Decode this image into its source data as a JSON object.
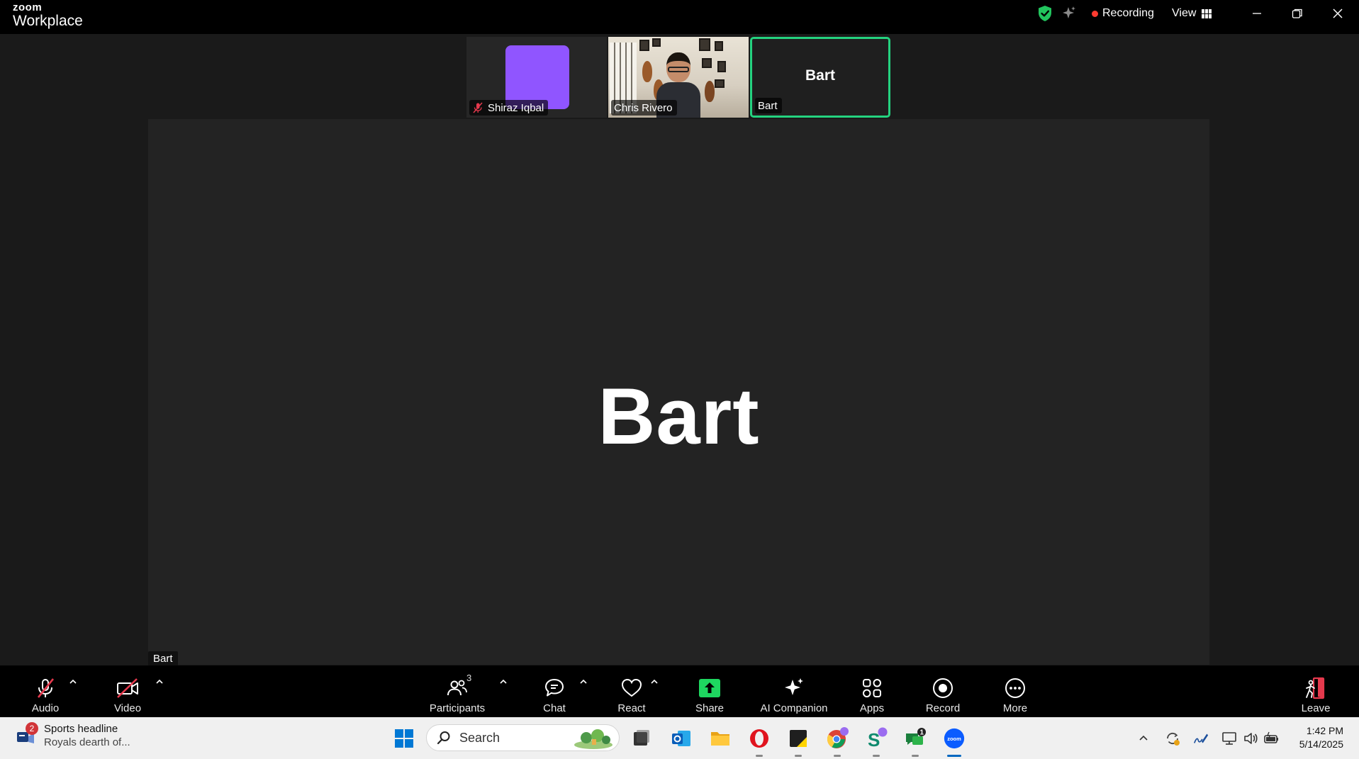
{
  "app": {
    "brand_small": "zoom",
    "brand_large": "Workplace"
  },
  "titlebar": {
    "recording_label": "Recording",
    "view_label": "View"
  },
  "colors": {
    "accent_green": "#24d27f",
    "recording_red": "#ff3b30",
    "avatar_purple": "#9055ff",
    "leave_red": "#e5394d"
  },
  "participants_strip": [
    {
      "name": "Shiraz Iqbal",
      "muted": true,
      "type": "avatar"
    },
    {
      "name": "Chris Rivero",
      "muted": false,
      "type": "video"
    },
    {
      "name": "Bart",
      "display_text": "Bart",
      "active_speaker": true
    }
  ],
  "main_view": {
    "display_name": "Bart",
    "name_tag": "Bart"
  },
  "toolbar": {
    "audio_label": "Audio",
    "video_label": "Video",
    "participants_label": "Participants",
    "participants_count": "3",
    "chat_label": "Chat",
    "react_label": "React",
    "share_label": "Share",
    "ai_label": "AI Companion",
    "apps_label": "Apps",
    "record_label": "Record",
    "more_label": "More",
    "leave_label": "Leave"
  },
  "taskbar": {
    "news_badge": "2",
    "news_title": "Sports headline",
    "news_subtitle": "Royals dearth of...",
    "search_placeholder": "Search",
    "teams_badge": "1",
    "time": "1:42 PM",
    "date": "5/14/2025",
    "apps": [
      "windows-start",
      "task-view",
      "outlook",
      "file-explorer",
      "opera",
      "sticky-notes",
      "chrome",
      "skype",
      "teams",
      "zoom"
    ]
  }
}
